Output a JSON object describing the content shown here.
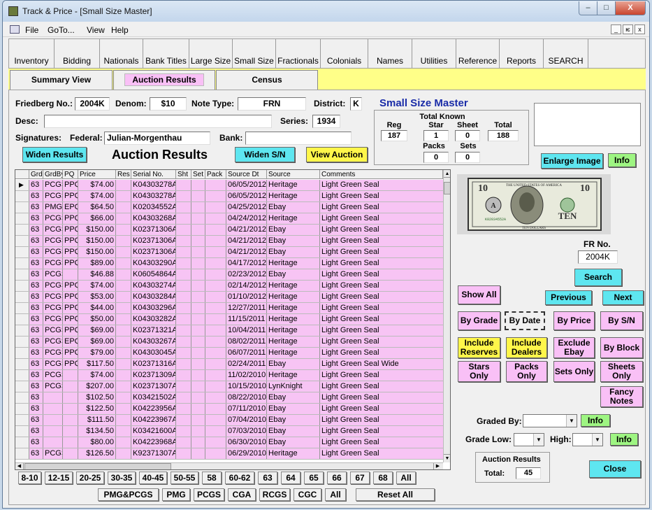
{
  "window": {
    "title": "Track & Price - [Small Size Master]",
    "min_glyph": "–",
    "max_glyph": "□",
    "close_glyph": "X"
  },
  "menu": [
    "File",
    "GoTo...",
    "View",
    "Help"
  ],
  "mdi": [
    "_",
    "ѥ",
    "x"
  ],
  "toolbar": [
    "Inventory",
    "Bidding",
    "Nationals",
    "Bank Titles",
    "Large Size",
    "Small Size",
    "Fractionals",
    "Colonials",
    "Names",
    "Utilities",
    "Reference",
    "Reports",
    "SEARCH"
  ],
  "tabs": [
    "Summary View",
    "Auction Results",
    "Census"
  ],
  "form": {
    "friedberg_label": "Friedberg No.:",
    "friedberg_value": "2004K",
    "denom_label": "Denom:",
    "denom_value": "$10",
    "note_type_label": "Note Type:",
    "note_type_value": "FRN",
    "district_label": "District:",
    "district_value": "K",
    "desc_label": "Desc:",
    "desc_value": "",
    "series_label": "Series:",
    "series_value": "1934",
    "signatures_label": "Signatures:",
    "federal_label": "Federal:",
    "federal_value": "Julian-Morgenthau",
    "bank_label": "Bank:",
    "bank_value": ""
  },
  "master_title": "Small Size Master",
  "total_known": {
    "title": "Total Known",
    "reg_label": "Reg",
    "reg_value": "187",
    "star_label": "Star",
    "star_value": "1",
    "sheet_label": "Sheet",
    "sheet_value": "0",
    "total_label": "Total",
    "total_value": "188",
    "packs_label": "Packs",
    "packs_value": "0",
    "sets_label": "Sets",
    "sets_value": "0"
  },
  "buttons": {
    "widen_results": "Widen Results",
    "auction_results_heading": "Auction Results",
    "widen_sn": "Widen S/N",
    "view_auction": "View Auction",
    "enlarge_image": "Enlarge Image",
    "info": "Info",
    "search": "Search",
    "show_all": "Show All",
    "previous": "Previous",
    "next": "Next",
    "by_grade": "By Grade",
    "by_date": "By Date",
    "by_price": "By Price",
    "by_sn": "By S/N",
    "include_reserves": "Include Reserves",
    "include_dealers": "Include Dealers",
    "exclude_ebay": "Exclude Ebay",
    "by_block": "By Block",
    "stars_only": "Stars Only",
    "packs_only": "Packs Only",
    "sets_only": "Sets Only",
    "sheets_only": "Sheets Only",
    "fancy_notes": "Fancy Notes",
    "close": "Close",
    "reset_all": "Reset All"
  },
  "note_image": {
    "top_text": "THE UNITED STATES OF AMERICA",
    "serial": "K02034552A",
    "denom": "10",
    "seal_letter": "A",
    "word": "TEN",
    "bottom_text": "TEN DOLLARS"
  },
  "fr_no_label": "FR No.",
  "fr_no_value": "2004K",
  "graded_by_label": "Graded By:",
  "graded_by_value": "",
  "grade_low_label": "Grade Low:",
  "grade_low_value": "",
  "high_label": "High:",
  "high_value": "",
  "auction_summary": {
    "title": "Auction Results",
    "total_label": "Total:",
    "total_value": "45"
  },
  "grid": {
    "columns": [
      "Grd",
      "GrdBy",
      "PQ",
      "Price",
      "Res",
      "Serial No.",
      "Sht",
      "Set",
      "Pack",
      "Source Dt",
      "Source",
      "Comments"
    ],
    "current_row_marker": "▶",
    "rows": [
      [
        "63",
        "PCGS",
        "PPQ",
        "$74.00",
        "",
        "K04303278A",
        "",
        "",
        "",
        "06/05/2012",
        "Heritage",
        "Light Green Seal"
      ],
      [
        "63",
        "PCGS",
        "PPQ",
        "$74.00",
        "",
        "K04303278A",
        "",
        "",
        "",
        "06/05/2012",
        "Heritage",
        "Light Green Seal"
      ],
      [
        "63",
        "PMG",
        "EPQ",
        "$64.50",
        "",
        "K02034552A",
        "",
        "",
        "",
        "04/25/2012",
        "Ebay",
        "Light Green Seal"
      ],
      [
        "63",
        "PCGS",
        "PPQ",
        "$66.00",
        "",
        "K04303268A",
        "",
        "",
        "",
        "04/24/2012",
        "Heritage",
        "Light Green Seal"
      ],
      [
        "63",
        "PCGS",
        "PPQ",
        "$150.00",
        "",
        "K02371306A",
        "",
        "",
        "",
        "04/21/2012",
        "Ebay",
        "Light Green Seal"
      ],
      [
        "63",
        "PCGS",
        "PPQ",
        "$150.00",
        "",
        "K02371306A",
        "",
        "",
        "",
        "04/21/2012",
        "Ebay",
        "Light Green Seal"
      ],
      [
        "63",
        "PCGS",
        "PPQ",
        "$150.00",
        "",
        "K02371306A",
        "",
        "",
        "",
        "04/21/2012",
        "Ebay",
        "Light Green Seal"
      ],
      [
        "63",
        "PCGS",
        "PPQ",
        "$89.00",
        "",
        "K04303290A",
        "",
        "",
        "",
        "04/17/2012",
        "Heritage",
        "Light Green Seal"
      ],
      [
        "63",
        "PCGS",
        "",
        "$46.88",
        "",
        "K06054864A",
        "",
        "",
        "",
        "02/23/2012",
        "Ebay",
        "Light Green Seal"
      ],
      [
        "63",
        "PCGS",
        "PPQ",
        "$74.00",
        "",
        "K04303274A",
        "",
        "",
        "",
        "02/14/2012",
        "Heritage",
        "Light Green Seal"
      ],
      [
        "63",
        "PCGS",
        "PPQ",
        "$53.00",
        "",
        "K04303284A",
        "",
        "",
        "",
        "01/10/2012",
        "Heritage",
        "Light Green Seal"
      ],
      [
        "63",
        "PCGS",
        "PPQ",
        "$44.00",
        "",
        "K04303296A",
        "",
        "",
        "",
        "12/27/2011",
        "Heritage",
        "Light Green Seal"
      ],
      [
        "63",
        "PCGS",
        "PPQ",
        "$50.00",
        "",
        "K04303282A",
        "",
        "",
        "",
        "11/15/2011",
        "Heritage",
        "Light Green Seal"
      ],
      [
        "63",
        "PCGS",
        "PPQ",
        "$69.00",
        "",
        "K02371321A",
        "",
        "",
        "",
        "10/04/2011",
        "Heritage",
        "Light Green Seal"
      ],
      [
        "63",
        "PCGS",
        "EPQ",
        "$69.00",
        "",
        "K04303267A",
        "",
        "",
        "",
        "08/02/2011",
        "Heritage",
        "Light Green Seal"
      ],
      [
        "63",
        "PCGS",
        "PPQ",
        "$79.00",
        "",
        "K04303045A",
        "",
        "",
        "",
        "06/07/2011",
        "Heritage",
        "Light Green Seal"
      ],
      [
        "63",
        "PCGS",
        "PPQ",
        "$117.50",
        "",
        "K02371316A",
        "",
        "",
        "",
        "02/24/2011",
        "Ebay",
        "Light Green Seal Wide"
      ],
      [
        "63",
        "PCGS",
        "",
        "$74.00",
        "",
        "K02371309A",
        "",
        "",
        "",
        "11/02/2010",
        "Heritage",
        "Light Green Seal"
      ],
      [
        "63",
        "PCGS",
        "",
        "$207.00",
        "",
        "K02371307A",
        "",
        "",
        "",
        "10/15/2010",
        "LynKnight",
        "Light Green Seal"
      ],
      [
        "63",
        "",
        "",
        "$102.50",
        "",
        "K03421502A",
        "",
        "",
        "",
        "08/22/2010",
        "Ebay",
        "Light Green Seal"
      ],
      [
        "63",
        "",
        "",
        "$122.50",
        "",
        "K04223956A",
        "",
        "",
        "",
        "07/11/2010",
        "Ebay",
        "Light Green Seal"
      ],
      [
        "63",
        "",
        "",
        "$111.50",
        "",
        "K04223967A",
        "",
        "",
        "",
        "07/04/2010",
        "Ebay",
        "Light Green Seal"
      ],
      [
        "63",
        "",
        "",
        "$134.50",
        "",
        "K03421600A",
        "",
        "",
        "",
        "07/03/2010",
        "Ebay",
        "Light Green Seal"
      ],
      [
        "63",
        "",
        "",
        "$80.00",
        "",
        "K04223968A",
        "",
        "",
        "",
        "06/30/2010",
        "Ebay",
        "Light Green Seal"
      ],
      [
        "63",
        "PCGS",
        "",
        "$126.50",
        "",
        "K92371307A",
        "",
        "",
        "",
        "06/29/2010",
        "Heritage",
        "Light Green Seal"
      ]
    ]
  },
  "grade_ranges": [
    "8-10",
    "12-15",
    "20-25",
    "30-35",
    "40-45",
    "50-55",
    "58",
    "60-62",
    "63",
    "64",
    "65",
    "66",
    "67",
    "68",
    "All"
  ],
  "grader_filters": [
    "PMG&PCGS",
    "PMG",
    "PCGS",
    "CGA",
    "RCGS",
    "CGC",
    "All"
  ],
  "colors": {
    "pink": "#f9c0f6",
    "cyan": "#5ee6f0",
    "yellow": "#fff64a",
    "green": "#9ef582",
    "title_blue": "#1a2ca8"
  }
}
